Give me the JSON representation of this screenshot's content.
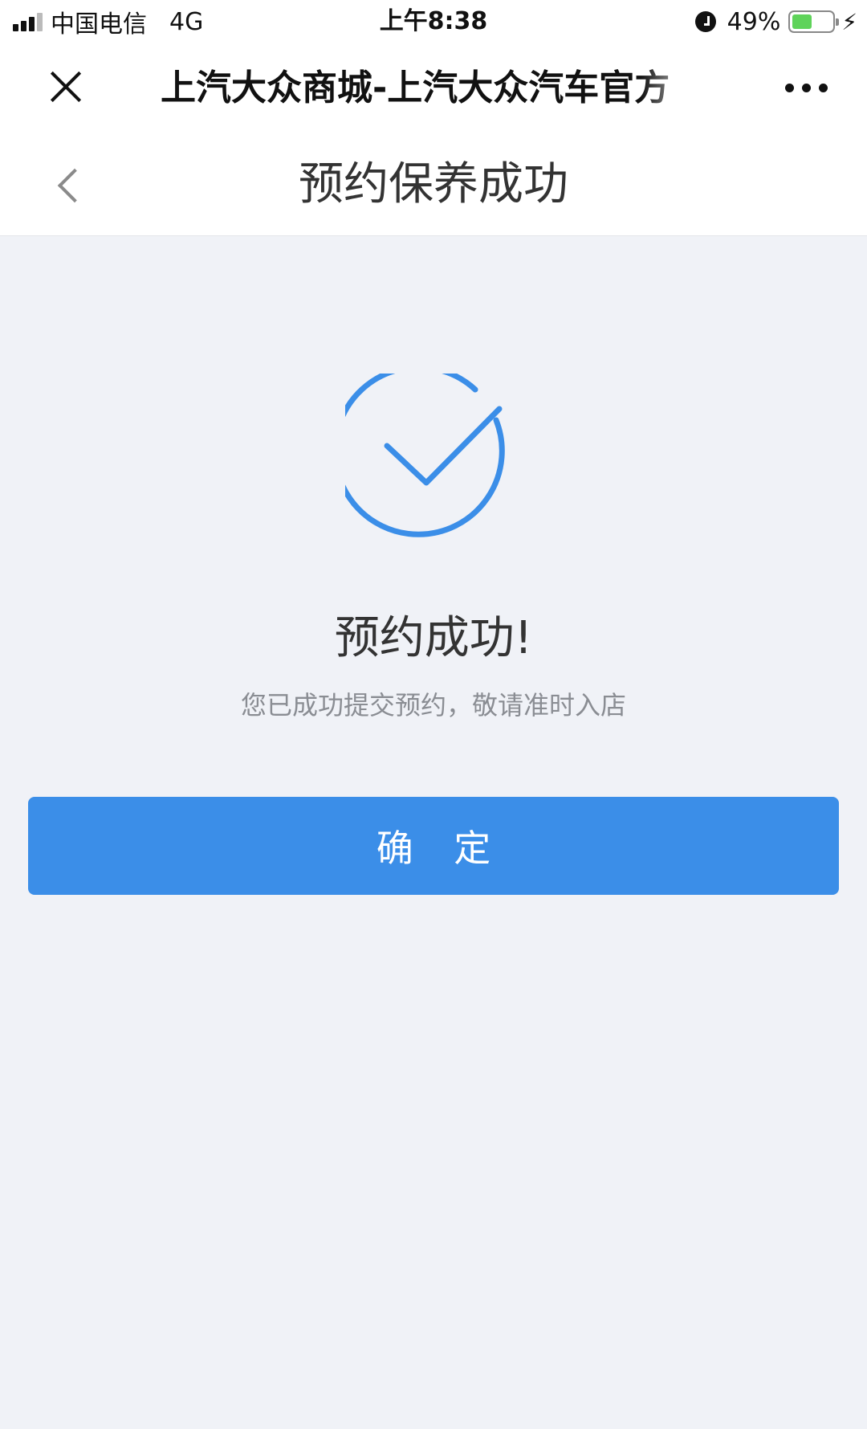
{
  "status_bar": {
    "carrier": "中国电信",
    "network": "4G",
    "time": "上午8:38",
    "battery_percent": "49%",
    "battery_level": 0.49,
    "icons": [
      "signal-icon",
      "alarm-icon",
      "battery-icon",
      "charging-icon"
    ]
  },
  "wechat_bar": {
    "title": "上汽大众商城-上汽大众汽车官方",
    "icons": [
      "close-icon",
      "more-icon"
    ]
  },
  "header": {
    "title": "预约保养成功",
    "icons": [
      "back-icon"
    ]
  },
  "result": {
    "icon": "success-check-icon",
    "title": "预约成功!",
    "description": "您已成功提交预约，敬请准时入店"
  },
  "actions": {
    "confirm_label": "确 定"
  },
  "colors": {
    "accent": "#3b8ee8",
    "background": "#f0f2f7",
    "battery": "#5fd35a"
  }
}
